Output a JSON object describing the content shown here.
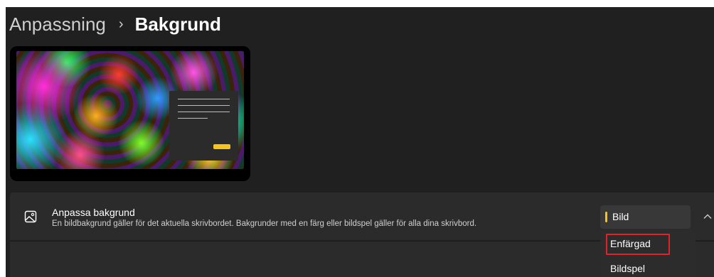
{
  "header": {
    "breadcrumb_parent": "Anpassning",
    "breadcrumb_separator": "›",
    "breadcrumb_current": "Bakgrund"
  },
  "card": {
    "icon": "image-icon",
    "title": "Anpassa bakgrund",
    "subtitle": "En bildbakgrund gäller för det aktuella skrivbordet. Bakgrunder med en färg eller bildspel gäller för alla dina skrivbord."
  },
  "select": {
    "current": "Bild",
    "options": [
      "Enfärgad",
      "Bildspel"
    ],
    "highlighted": "Enfärgad"
  },
  "colors": {
    "accent": "#f8c41a",
    "highlight_border": "#e0232b",
    "background": "#202020",
    "card": "#2b2b2b"
  }
}
